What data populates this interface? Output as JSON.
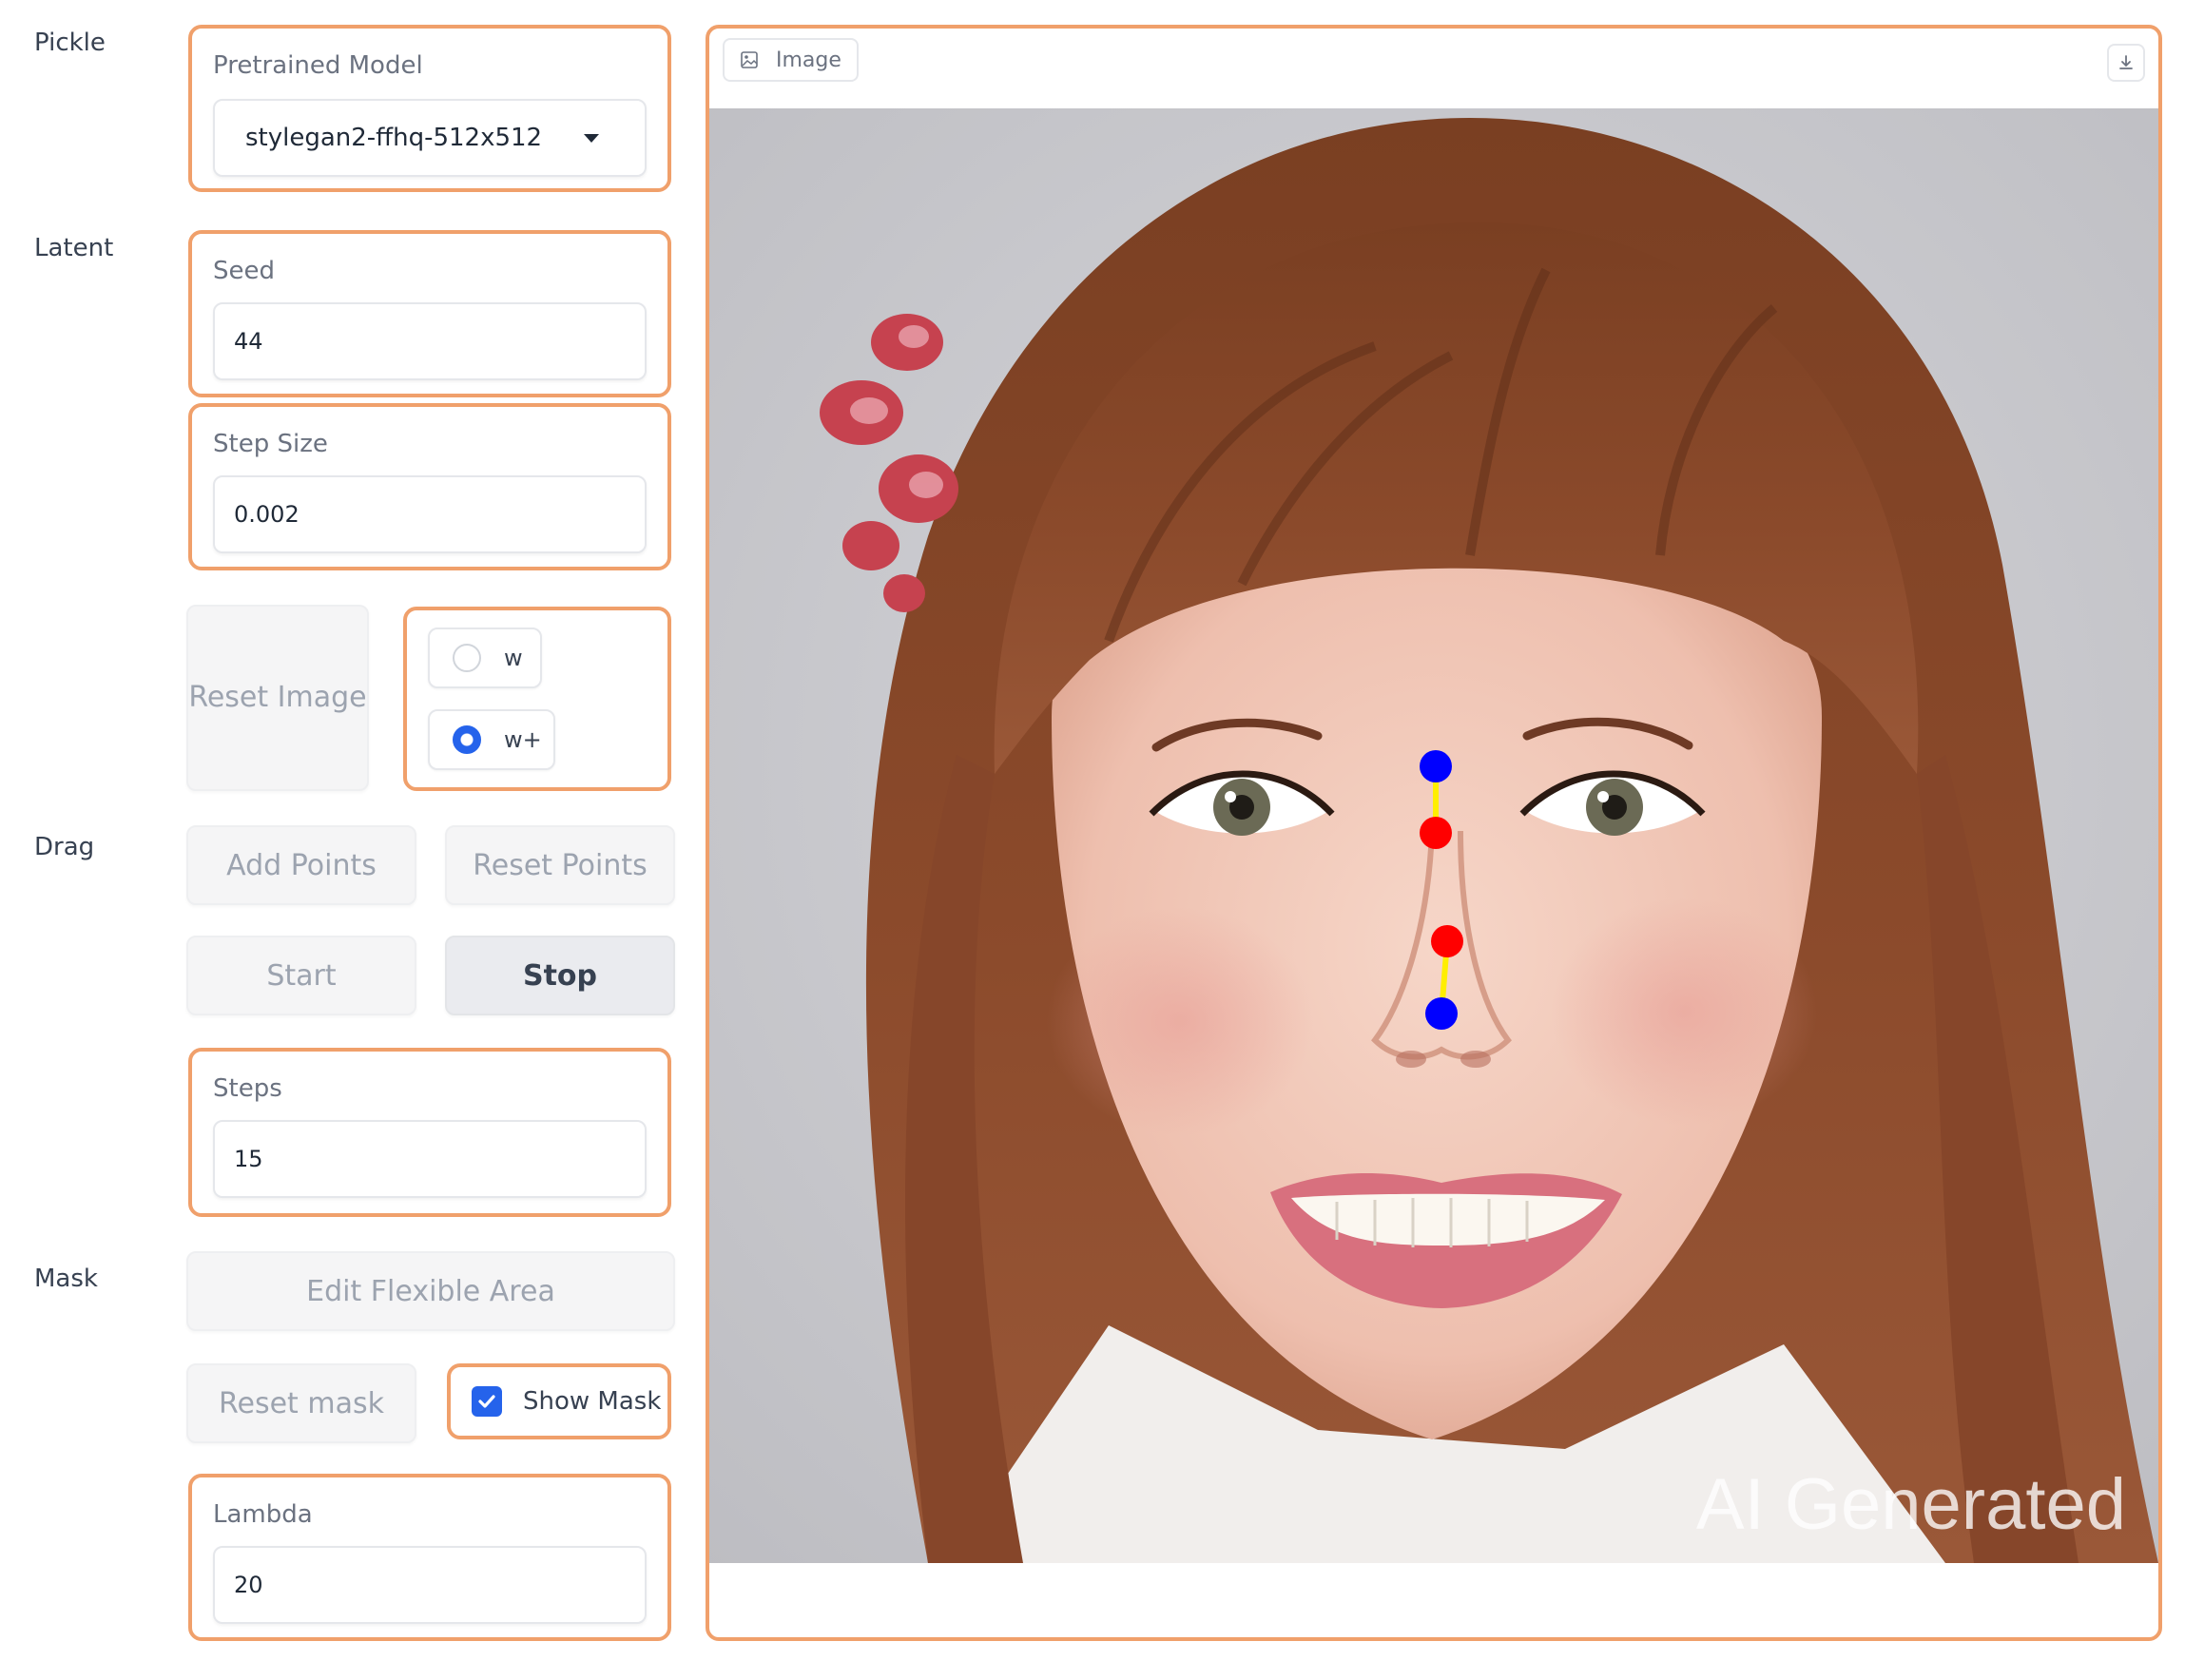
{
  "sections": {
    "pickle": "Pickle",
    "latent": "Latent",
    "drag": "Drag",
    "mask": "Mask"
  },
  "pretrained_model": {
    "label": "Pretrained Model",
    "selected": "stylegan2-ffhq-512x512"
  },
  "seed": {
    "label": "Seed",
    "value": "44"
  },
  "step_size": {
    "label": "Step Size",
    "value": "0.002"
  },
  "reset_image": {
    "label": "Reset Image"
  },
  "latent_space": {
    "options": [
      "w",
      "w+"
    ],
    "selected": "w+"
  },
  "drag_buttons": {
    "add_points": "Add Points",
    "reset_points": "Reset Points",
    "start": "Start",
    "stop": "Stop"
  },
  "steps": {
    "label": "Steps",
    "value": "15"
  },
  "mask_controls": {
    "edit_flexible_area": "Edit Flexible Area",
    "reset_mask": "Reset mask",
    "show_mask": "Show Mask",
    "show_mask_checked": true
  },
  "lambda": {
    "label": "Lambda",
    "value": "20"
  },
  "image_panel": {
    "tab_label": "Image",
    "watermark": "AI Generated"
  },
  "colors": {
    "accent_border": "#f0a06b",
    "handle_point": "#0000ff",
    "target_point": "#ff0000",
    "drag_line": "#ffee00",
    "checkbox": "#2563eb"
  },
  "icons": {
    "image_tab": "image-icon",
    "download": "download-icon",
    "dropdown": "chevron-down-icon"
  }
}
